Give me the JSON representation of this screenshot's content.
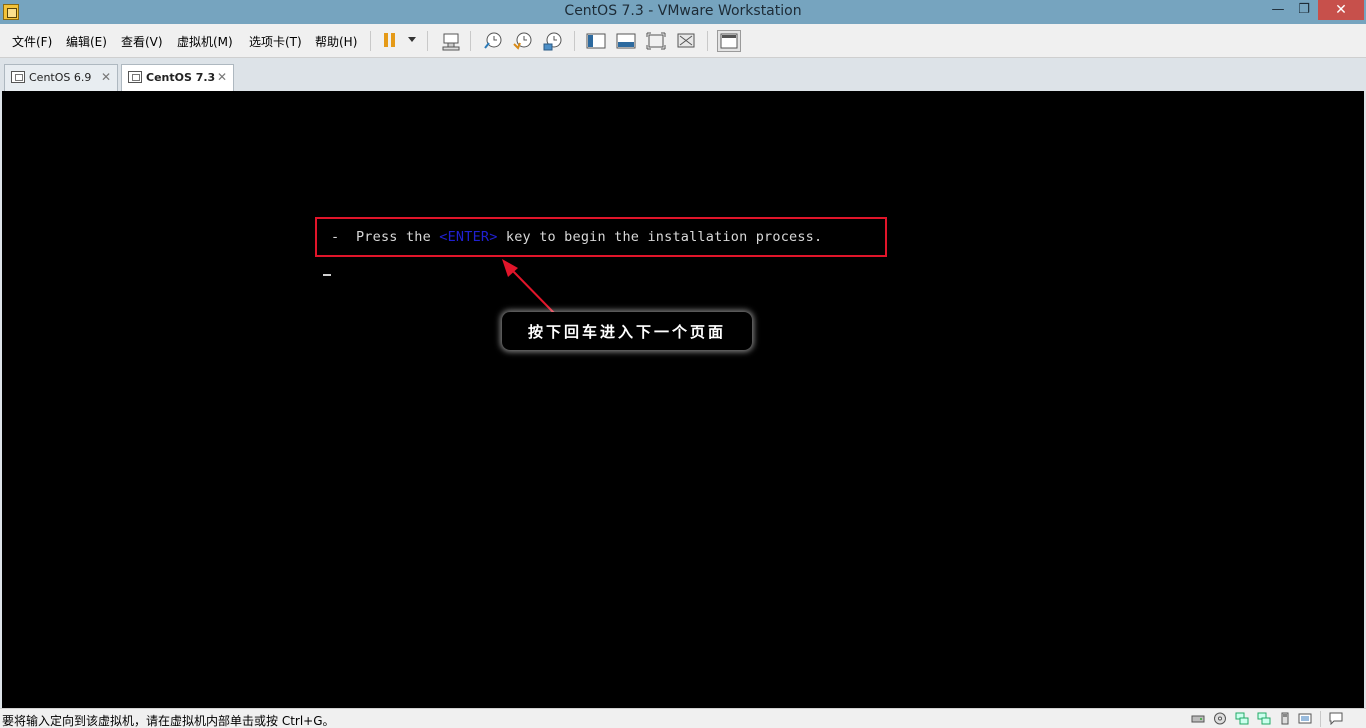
{
  "window": {
    "title": "CentOS 7.3 - VMware Workstation",
    "minimize_glyph": "—",
    "restore_glyph": "❐",
    "close_glyph": "✕"
  },
  "menu": {
    "file": "文件(F)",
    "edit": "编辑(E)",
    "view": "查看(V)",
    "vm": "虚拟机(M)",
    "tabs": "选项卡(T)",
    "help": "帮助(H)"
  },
  "toolbar_icons": [
    "pause-icon",
    "dropdown-icon",
    "send-ctrl-alt-del-icon",
    "snapshot-icon",
    "revert-snapshot-icon",
    "snapshot-manager-icon",
    "sidebar-icon",
    "console-view-icon",
    "fullscreen-icon",
    "unity-icon",
    "thumbnail-view-icon"
  ],
  "tabs": [
    {
      "label": "CentOS 6.9",
      "close": "✕"
    },
    {
      "label": "CentOS 7.3",
      "close": "✕"
    }
  ],
  "console": {
    "prompt_prefix": "-  Press the ",
    "enter_key": "<ENTER>",
    "prompt_suffix": " key to begin the installation process."
  },
  "annotation": {
    "text": "按下回车进入下一个页面",
    "border_color": "#e1152a"
  },
  "status": {
    "text": "要将输入定向到该虚拟机，请在虚拟机内部单击或按 Ctrl+G。"
  },
  "colors": {
    "titlebar": "#76a4bf",
    "accent_red": "#e1152a",
    "enter_blue": "#2020d0"
  }
}
